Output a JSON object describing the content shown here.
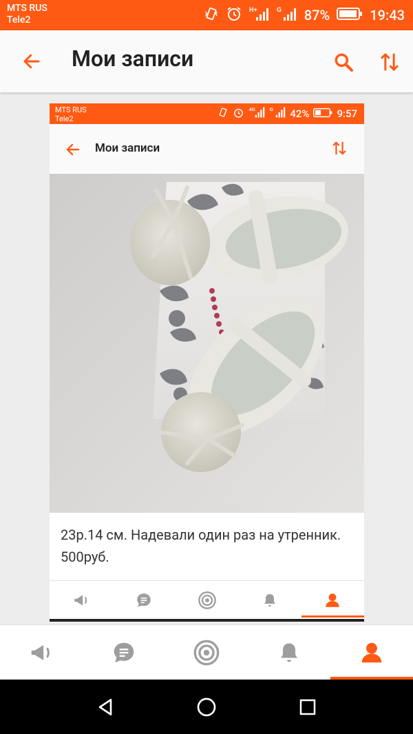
{
  "status_bar": {
    "carrier_1": "MTS RUS",
    "carrier_2": "Tele2",
    "battery_pct": "87%",
    "time": "19:43"
  },
  "toolbar": {
    "title": "Мои записи",
    "back_icon": "arrow-left-icon",
    "search_icon": "search-icon",
    "sort_icon": "sort-arrows-icon"
  },
  "embedded_screenshot": {
    "status_bar": {
      "carrier_1": "MTS RUS",
      "carrier_2": "Tele2",
      "battery_pct": "42%",
      "time": "9:57"
    },
    "toolbar": {
      "title": "Мои записи"
    },
    "post_text": "23р.14 см. Надевали один раз на утренник. 500руб.",
    "nav_items": [
      "megaphone-icon",
      "chat-icon",
      "target-icon",
      "bell-icon",
      "profile-icon"
    ],
    "active_nav": 4
  },
  "bottom_nav": {
    "items": [
      "megaphone-icon",
      "chat-icon",
      "target-icon",
      "bell-icon",
      "profile-icon"
    ],
    "active_index": 4
  },
  "system_nav": [
    "back-triangle-icon",
    "home-circle-icon",
    "recents-square-icon"
  ],
  "colors": {
    "accent": "#ff5a14",
    "inactive_icon": "#9e9e9e"
  }
}
